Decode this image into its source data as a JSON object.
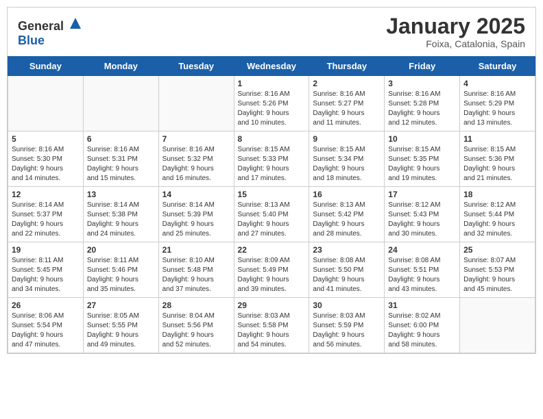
{
  "header": {
    "logo_general": "General",
    "logo_blue": "Blue",
    "month": "January 2025",
    "location": "Foixa, Catalonia, Spain"
  },
  "weekdays": [
    "Sunday",
    "Monday",
    "Tuesday",
    "Wednesday",
    "Thursday",
    "Friday",
    "Saturday"
  ],
  "weeks": [
    [
      {
        "day": "",
        "info": ""
      },
      {
        "day": "",
        "info": ""
      },
      {
        "day": "",
        "info": ""
      },
      {
        "day": "1",
        "info": "Sunrise: 8:16 AM\nSunset: 5:26 PM\nDaylight: 9 hours\nand 10 minutes."
      },
      {
        "day": "2",
        "info": "Sunrise: 8:16 AM\nSunset: 5:27 PM\nDaylight: 9 hours\nand 11 minutes."
      },
      {
        "day": "3",
        "info": "Sunrise: 8:16 AM\nSunset: 5:28 PM\nDaylight: 9 hours\nand 12 minutes."
      },
      {
        "day": "4",
        "info": "Sunrise: 8:16 AM\nSunset: 5:29 PM\nDaylight: 9 hours\nand 13 minutes."
      }
    ],
    [
      {
        "day": "5",
        "info": "Sunrise: 8:16 AM\nSunset: 5:30 PM\nDaylight: 9 hours\nand 14 minutes."
      },
      {
        "day": "6",
        "info": "Sunrise: 8:16 AM\nSunset: 5:31 PM\nDaylight: 9 hours\nand 15 minutes."
      },
      {
        "day": "7",
        "info": "Sunrise: 8:16 AM\nSunset: 5:32 PM\nDaylight: 9 hours\nand 16 minutes."
      },
      {
        "day": "8",
        "info": "Sunrise: 8:15 AM\nSunset: 5:33 PM\nDaylight: 9 hours\nand 17 minutes."
      },
      {
        "day": "9",
        "info": "Sunrise: 8:15 AM\nSunset: 5:34 PM\nDaylight: 9 hours\nand 18 minutes."
      },
      {
        "day": "10",
        "info": "Sunrise: 8:15 AM\nSunset: 5:35 PM\nDaylight: 9 hours\nand 19 minutes."
      },
      {
        "day": "11",
        "info": "Sunrise: 8:15 AM\nSunset: 5:36 PM\nDaylight: 9 hours\nand 21 minutes."
      }
    ],
    [
      {
        "day": "12",
        "info": "Sunrise: 8:14 AM\nSunset: 5:37 PM\nDaylight: 9 hours\nand 22 minutes."
      },
      {
        "day": "13",
        "info": "Sunrise: 8:14 AM\nSunset: 5:38 PM\nDaylight: 9 hours\nand 24 minutes."
      },
      {
        "day": "14",
        "info": "Sunrise: 8:14 AM\nSunset: 5:39 PM\nDaylight: 9 hours\nand 25 minutes."
      },
      {
        "day": "15",
        "info": "Sunrise: 8:13 AM\nSunset: 5:40 PM\nDaylight: 9 hours\nand 27 minutes."
      },
      {
        "day": "16",
        "info": "Sunrise: 8:13 AM\nSunset: 5:42 PM\nDaylight: 9 hours\nand 28 minutes."
      },
      {
        "day": "17",
        "info": "Sunrise: 8:12 AM\nSunset: 5:43 PM\nDaylight: 9 hours\nand 30 minutes."
      },
      {
        "day": "18",
        "info": "Sunrise: 8:12 AM\nSunset: 5:44 PM\nDaylight: 9 hours\nand 32 minutes."
      }
    ],
    [
      {
        "day": "19",
        "info": "Sunrise: 8:11 AM\nSunset: 5:45 PM\nDaylight: 9 hours\nand 34 minutes."
      },
      {
        "day": "20",
        "info": "Sunrise: 8:11 AM\nSunset: 5:46 PM\nDaylight: 9 hours\nand 35 minutes."
      },
      {
        "day": "21",
        "info": "Sunrise: 8:10 AM\nSunset: 5:48 PM\nDaylight: 9 hours\nand 37 minutes."
      },
      {
        "day": "22",
        "info": "Sunrise: 8:09 AM\nSunset: 5:49 PM\nDaylight: 9 hours\nand 39 minutes."
      },
      {
        "day": "23",
        "info": "Sunrise: 8:08 AM\nSunset: 5:50 PM\nDaylight: 9 hours\nand 41 minutes."
      },
      {
        "day": "24",
        "info": "Sunrise: 8:08 AM\nSunset: 5:51 PM\nDaylight: 9 hours\nand 43 minutes."
      },
      {
        "day": "25",
        "info": "Sunrise: 8:07 AM\nSunset: 5:53 PM\nDaylight: 9 hours\nand 45 minutes."
      }
    ],
    [
      {
        "day": "26",
        "info": "Sunrise: 8:06 AM\nSunset: 5:54 PM\nDaylight: 9 hours\nand 47 minutes."
      },
      {
        "day": "27",
        "info": "Sunrise: 8:05 AM\nSunset: 5:55 PM\nDaylight: 9 hours\nand 49 minutes."
      },
      {
        "day": "28",
        "info": "Sunrise: 8:04 AM\nSunset: 5:56 PM\nDaylight: 9 hours\nand 52 minutes."
      },
      {
        "day": "29",
        "info": "Sunrise: 8:03 AM\nSunset: 5:58 PM\nDaylight: 9 hours\nand 54 minutes."
      },
      {
        "day": "30",
        "info": "Sunrise: 8:03 AM\nSunset: 5:59 PM\nDaylight: 9 hours\nand 56 minutes."
      },
      {
        "day": "31",
        "info": "Sunrise: 8:02 AM\nSunset: 6:00 PM\nDaylight: 9 hours\nand 58 minutes."
      },
      {
        "day": "",
        "info": ""
      }
    ]
  ]
}
